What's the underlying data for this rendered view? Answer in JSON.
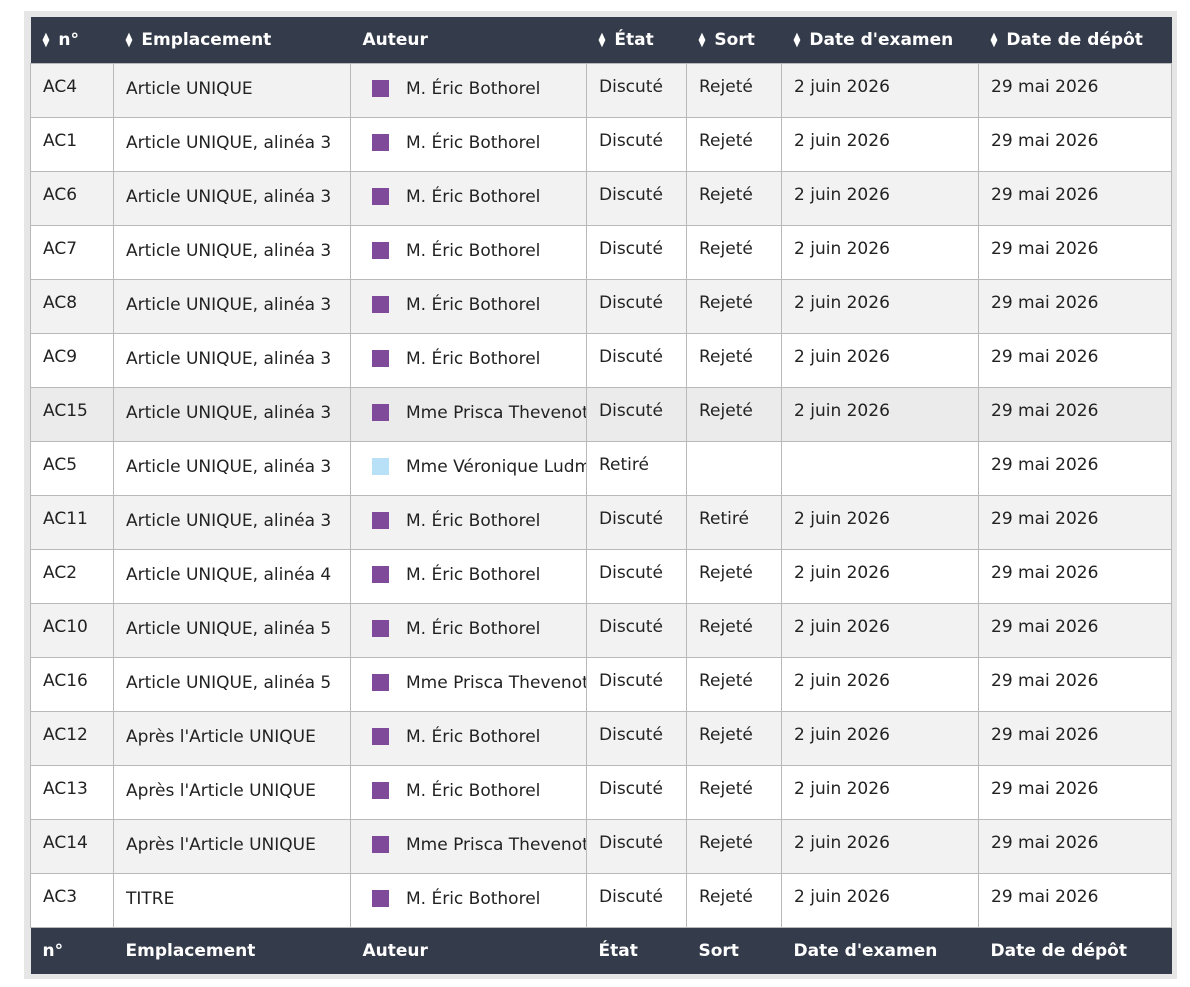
{
  "headers": {
    "num": "n°",
    "loc": "Emplacement",
    "author": "Auteur",
    "state": "État",
    "fate": "Sort",
    "exam": "Date d'examen",
    "deposit": "Date de dépôt"
  },
  "colors": {
    "header_bg": "#343b4a",
    "group_purple": "#7f4a99",
    "group_lightblue": "#b8e0f7"
  },
  "rows": [
    {
      "num": "AC4",
      "loc": "Article UNIQUE",
      "author": "M. Éric Bothorel",
      "color": "#7f4a99",
      "state": "Discuté",
      "fate": "Rejeté",
      "exam": "2 juin 2026",
      "deposit": "29 mai 2026"
    },
    {
      "num": "AC1",
      "loc": "Article UNIQUE, alinéa 3",
      "author": "M. Éric Bothorel",
      "color": "#7f4a99",
      "state": "Discuté",
      "fate": "Rejeté",
      "exam": "2 juin 2026",
      "deposit": "29 mai 2026"
    },
    {
      "num": "AC6",
      "loc": "Article UNIQUE, alinéa 3",
      "author": "M. Éric Bothorel",
      "color": "#7f4a99",
      "state": "Discuté",
      "fate": "Rejeté",
      "exam": "2 juin 2026",
      "deposit": "29 mai 2026"
    },
    {
      "num": "AC7",
      "loc": "Article UNIQUE, alinéa 3",
      "author": "M. Éric Bothorel",
      "color": "#7f4a99",
      "state": "Discuté",
      "fate": "Rejeté",
      "exam": "2 juin 2026",
      "deposit": "29 mai 2026"
    },
    {
      "num": "AC8",
      "loc": "Article UNIQUE, alinéa 3",
      "author": "M. Éric Bothorel",
      "color": "#7f4a99",
      "state": "Discuté",
      "fate": "Rejeté",
      "exam": "2 juin 2026",
      "deposit": "29 mai 2026"
    },
    {
      "num": "AC9",
      "loc": "Article UNIQUE, alinéa 3",
      "author": "M. Éric Bothorel",
      "color": "#7f4a99",
      "state": "Discuté",
      "fate": "Rejeté",
      "exam": "2 juin 2026",
      "deposit": "29 mai 2026"
    },
    {
      "num": "AC15",
      "loc": "Article UNIQUE, alinéa 3",
      "author": "Mme Prisca Thevenot",
      "color": "#7f4a99",
      "state": "Discuté",
      "fate": "Rejeté",
      "exam": "2 juin 2026",
      "deposit": "29 mai 2026"
    },
    {
      "num": "AC5",
      "loc": "Article UNIQUE, alinéa 3",
      "author": "Mme Véronique Ludmila",
      "color": "#b8e0f7",
      "state": "Retiré",
      "fate": "",
      "exam": "",
      "deposit": "29 mai 2026"
    },
    {
      "num": "AC11",
      "loc": "Article UNIQUE, alinéa 3",
      "author": "M. Éric Bothorel",
      "color": "#7f4a99",
      "state": "Discuté",
      "fate": "Retiré",
      "exam": "2 juin 2026",
      "deposit": "29 mai 2026"
    },
    {
      "num": "AC2",
      "loc": "Article UNIQUE, alinéa 4",
      "author": "M. Éric Bothorel",
      "color": "#7f4a99",
      "state": "Discuté",
      "fate": "Rejeté",
      "exam": "2 juin 2026",
      "deposit": "29 mai 2026"
    },
    {
      "num": "AC10",
      "loc": "Article UNIQUE, alinéa 5",
      "author": "M. Éric Bothorel",
      "color": "#7f4a99",
      "state": "Discuté",
      "fate": "Rejeté",
      "exam": "2 juin 2026",
      "deposit": "29 mai 2026"
    },
    {
      "num": "AC16",
      "loc": "Article UNIQUE, alinéa 5",
      "author": "Mme Prisca Thevenot",
      "color": "#7f4a99",
      "state": "Discuté",
      "fate": "Rejeté",
      "exam": "2 juin 2026",
      "deposit": "29 mai 2026"
    },
    {
      "num": "AC12",
      "loc": "Après l'Article UNIQUE",
      "author": "M. Éric Bothorel",
      "color": "#7f4a99",
      "state": "Discuté",
      "fate": "Rejeté",
      "exam": "2 juin 2026",
      "deposit": "29 mai 2026"
    },
    {
      "num": "AC13",
      "loc": "Après l'Article UNIQUE",
      "author": "M. Éric Bothorel",
      "color": "#7f4a99",
      "state": "Discuté",
      "fate": "Rejeté",
      "exam": "2 juin 2026",
      "deposit": "29 mai 2026"
    },
    {
      "num": "AC14",
      "loc": "Après l'Article UNIQUE",
      "author": "Mme Prisca Thevenot",
      "color": "#7f4a99",
      "state": "Discuté",
      "fate": "Rejeté",
      "exam": "2 juin 2026",
      "deposit": "29 mai 2026"
    },
    {
      "num": "AC3",
      "loc": "TITRE",
      "author": "M. Éric Bothorel",
      "color": "#7f4a99",
      "state": "Discuté",
      "fate": "Rejeté",
      "exam": "2 juin 2026",
      "deposit": "29 mai 2026"
    }
  ]
}
